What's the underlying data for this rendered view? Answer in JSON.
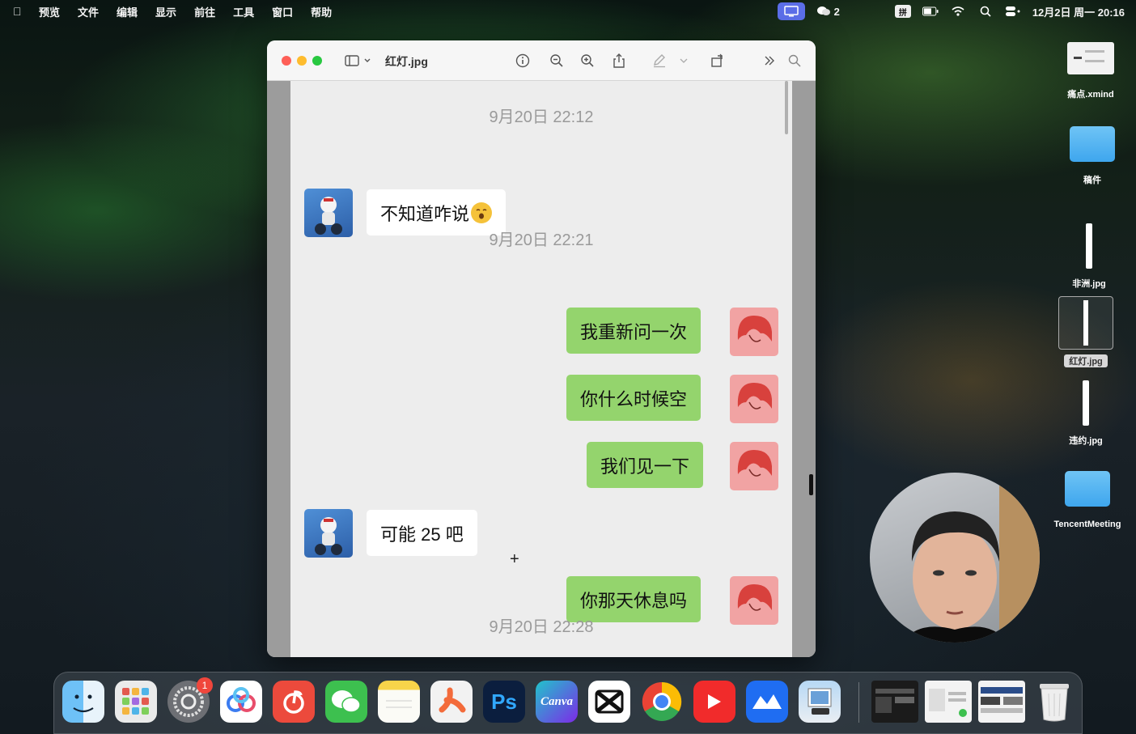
{
  "menubar": {
    "app": "预览",
    "items": [
      "文件",
      "编辑",
      "显示",
      "前往",
      "工具",
      "窗口",
      "帮助"
    ],
    "wechat_count": "2",
    "ime": "拼",
    "datetime": "12月2日 周一 20:16"
  },
  "window": {
    "title": "红灯.jpg"
  },
  "chat": {
    "timestamps": [
      "9月20日 22:12",
      "9月20日 22:21",
      "9月20日 22:28"
    ],
    "messages": [
      {
        "side": "left",
        "text": "不知道咋说"
      },
      {
        "side": "right",
        "text": "我重新问一次"
      },
      {
        "side": "right",
        "text": "你什么时候空"
      },
      {
        "side": "right",
        "text": "我们见一下"
      },
      {
        "side": "left",
        "text": "可能 25 吧"
      },
      {
        "side": "right",
        "text": "你那天休息吗"
      }
    ]
  },
  "desktop": {
    "items": [
      "痛点.xmind",
      "稿件",
      "非洲.jpg",
      "红灯.jpg",
      "违约.jpg",
      "TencentMeeting"
    ]
  },
  "dock": {
    "badge": "1",
    "apps": [
      "Finder",
      "Launchpad",
      "System Settings",
      "Baidu Netdisk",
      "NetEase Music",
      "WeChat",
      "Notes",
      "XMind",
      "Ps",
      "Canva",
      "CapCut",
      "Chrome",
      "YouTube",
      "Lark",
      "Preview"
    ]
  }
}
